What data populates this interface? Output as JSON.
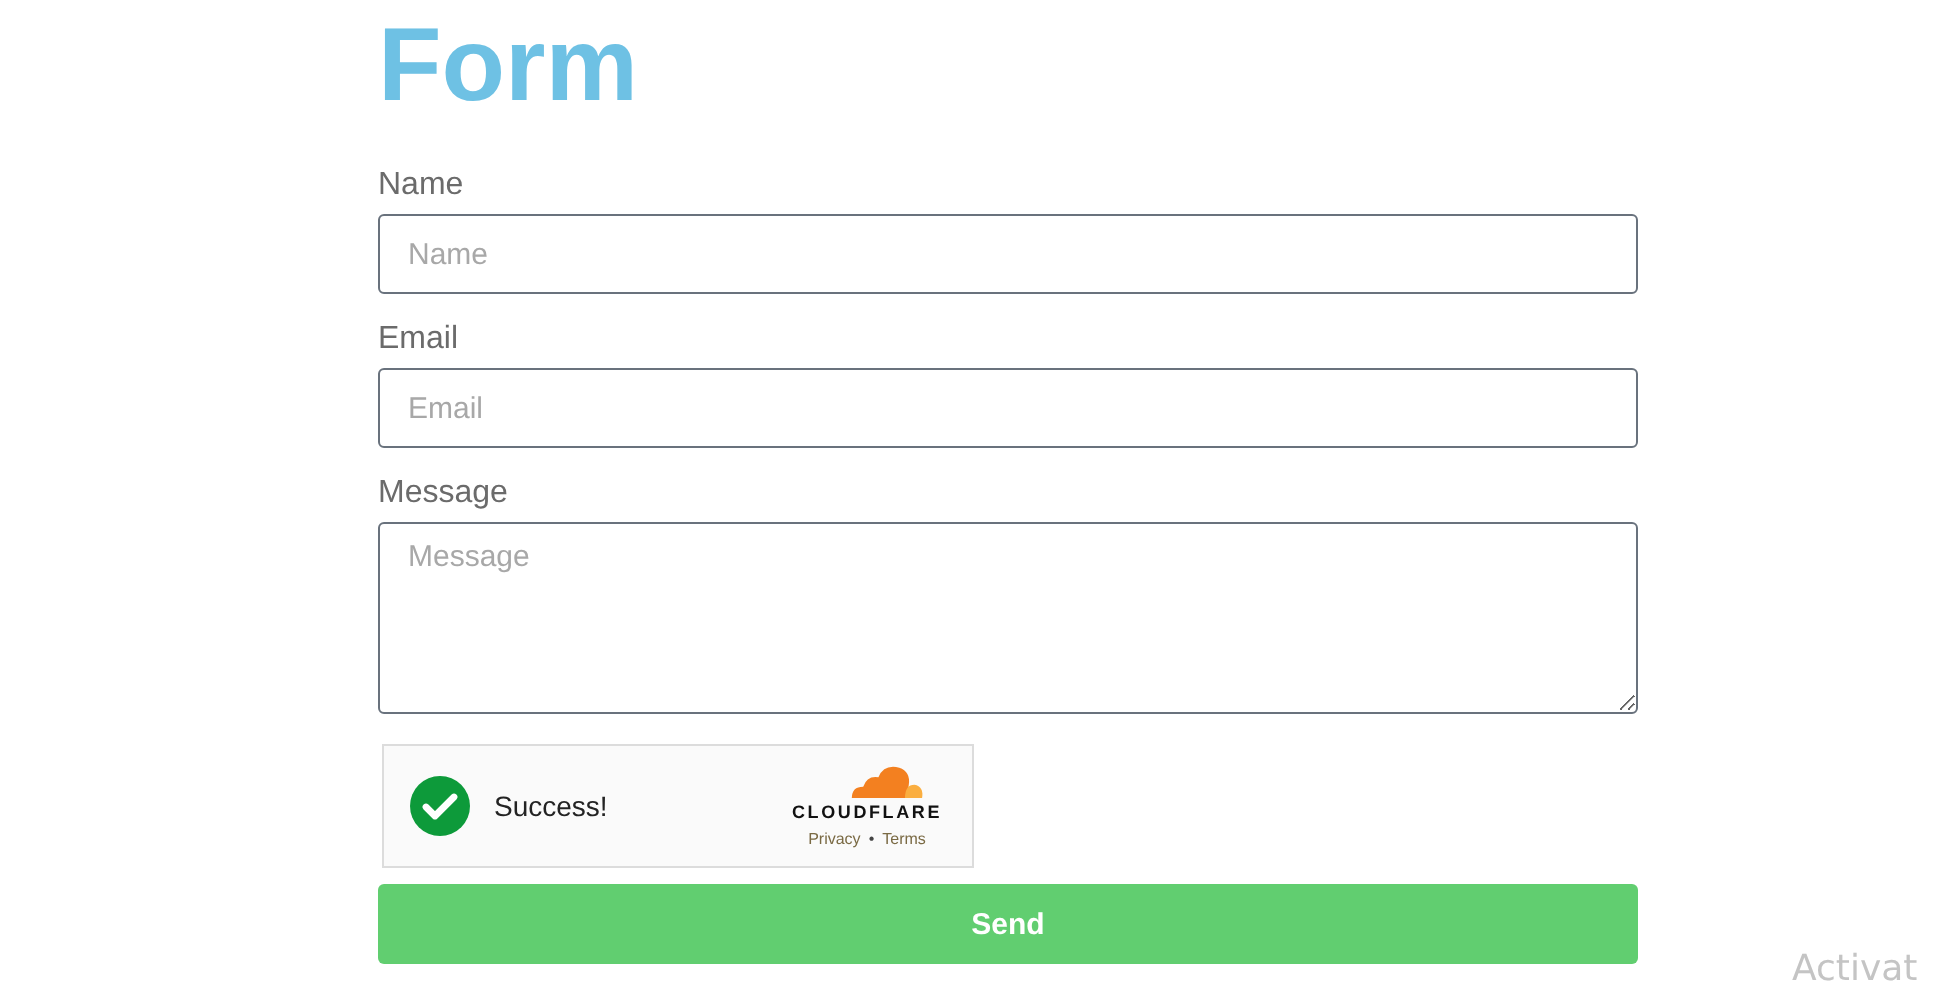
{
  "title": "Form",
  "fields": [
    {
      "kind": "input",
      "label": "Name",
      "placeholder": "Name"
    },
    {
      "kind": "input",
      "label": "Email",
      "placeholder": "Email"
    },
    {
      "kind": "textarea",
      "label": "Message",
      "placeholder": "Message"
    }
  ],
  "captcha": {
    "verified": true,
    "message": "Success!",
    "brand": "CLOUDFLARE",
    "links": [
      "Privacy",
      "Terms"
    ],
    "separator": "•"
  },
  "submit": "Send",
  "overlay_text": "Activat"
}
